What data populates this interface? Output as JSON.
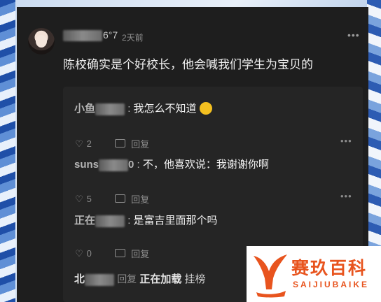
{
  "post": {
    "username_suffix": "6°7",
    "timestamp": "2天前",
    "more": "⋮",
    "comment": "陈校确实是个好校长，他会喊我们学生为宝贝的"
  },
  "replies": [
    {
      "name_prefix": "小鱼",
      "name_suffix": "",
      "separator": ":",
      "text": "我怎么不知道",
      "likes": "2",
      "reply_label": "回复"
    },
    {
      "name_prefix": "suns",
      "name_suffix": "0",
      "separator": ":",
      "text": "不，他喜欢说：我谢谢你啊",
      "likes": "5",
      "reply_label": "回复"
    },
    {
      "name_prefix": "正在",
      "name_suffix": "",
      "separator": ":",
      "text": "是富吉里面那个吗",
      "likes": "0",
      "reply_label": "回复"
    }
  ],
  "last_line": {
    "name_prefix": "北",
    "reply_word": "回复",
    "bold_text": "正在加载",
    "text": "挂榜"
  },
  "watermark": {
    "brand_cn": "赛玖百科",
    "brand_en": "SAIJIUBAIKE"
  },
  "colors": {
    "card": "#1e1e1e",
    "replies_bg": "#252525",
    "brand": "#e8541e"
  }
}
